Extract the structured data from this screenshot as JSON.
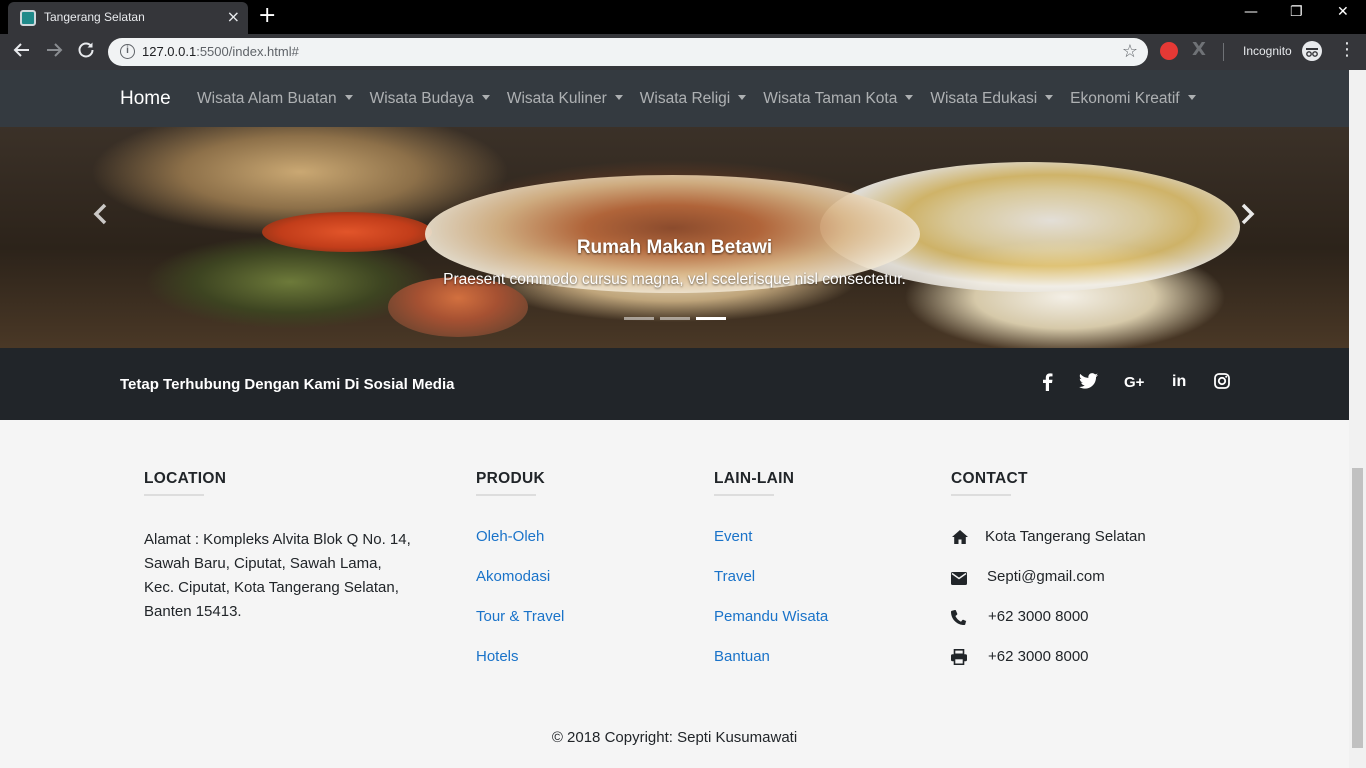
{
  "browser": {
    "tab_title": "Tangerang Selatan",
    "tab_close": "×",
    "new_tab": "+",
    "url_host": "127.0.0.1",
    "url_rest": ":5500/index.html#",
    "incognito_label": "Incognito",
    "window_controls": {
      "minimize": "—",
      "restore": "❐",
      "close": "✕"
    }
  },
  "nav": {
    "brand": "Home",
    "items": [
      {
        "label": "Wisata Alam Buatan"
      },
      {
        "label": "Wisata Budaya"
      },
      {
        "label": "Wisata Kuliner"
      },
      {
        "label": "Wisata Religi"
      },
      {
        "label": "Wisata Taman Kota"
      },
      {
        "label": "Wisata Edukasi"
      },
      {
        "label": "Ekonomi Kreatif"
      }
    ]
  },
  "carousel": {
    "title": "Rumah Makan Betawi",
    "text": "Praesent commodo cursus magna, vel scelerisque nisl consectetur.",
    "slide_count": 3,
    "active_slide": 3
  },
  "social": {
    "text": "Tetap Terhubung Dengan Kami Di Sosial Media",
    "icons": [
      "facebook-icon",
      "twitter-icon",
      "google-plus-icon",
      "linkedin-icon",
      "instagram-icon"
    ],
    "google_plus_label": "G+",
    "linkedin_label": "in"
  },
  "footer": {
    "location": {
      "heading": "LOCATION",
      "address": "Alamat : Kompleks Alvita Blok Q No. 14, Sawah Baru, Ciputat, Sawah Lama, Kec. Ciputat, Kota Tangerang Selatan, Banten 15413."
    },
    "produk": {
      "heading": "PRODUK",
      "links": [
        "Oleh-Oleh",
        "Akomodasi",
        "Tour & Travel",
        "Hotels"
      ]
    },
    "lain": {
      "heading": "LAIN-LAIN",
      "links": [
        "Event",
        "Travel",
        "Pemandu Wisata",
        "Bantuan"
      ]
    },
    "contact": {
      "heading": "CONTACT",
      "items": [
        {
          "icon": "home-icon",
          "text": "Kota Tangerang Selatan"
        },
        {
          "icon": "envelope-icon",
          "text": "Septi@gmail.com"
        },
        {
          "icon": "phone-icon",
          "text": "+62 3000 8000"
        },
        {
          "icon": "print-icon",
          "text": "+62 3000 8000"
        }
      ]
    },
    "copyright": "© 2018 Copyright: Septi Kusumawati"
  },
  "colors": {
    "nav_bg": "#343a40",
    "social_bg": "#212529",
    "link": "#1a73c9",
    "footer_bg": "#f5f5f5"
  }
}
